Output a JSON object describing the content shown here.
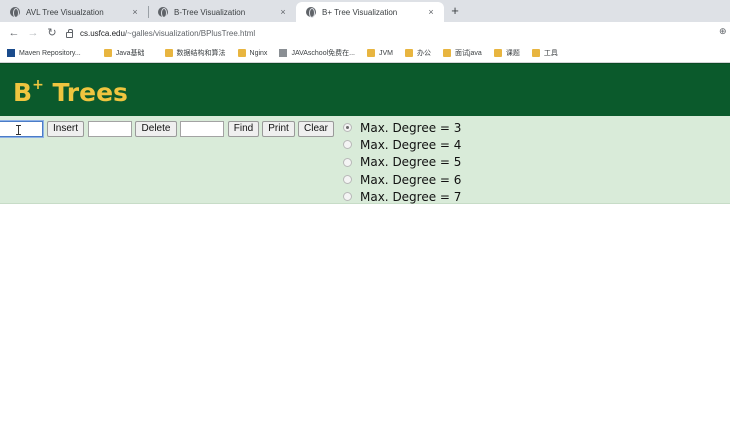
{
  "browser": {
    "tabs": [
      {
        "title": "AVL Tree Visualzation",
        "active": false
      },
      {
        "title": "B-Tree Visualization",
        "active": false
      },
      {
        "title": "B+ Tree Visualization",
        "active": true
      }
    ],
    "close_glyph": "×",
    "new_tab_glyph": "+",
    "url_host": "cs.usfca.edu",
    "url_path": "/~galles/visualization/BPlusTree.html",
    "nav": {
      "back": "←",
      "forward": "→",
      "reload": "↻"
    },
    "zoom_glyph": "⊕",
    "bookmarks": [
      {
        "label": "Maven Repository...",
        "icon": "maven-icon"
      },
      {
        "label": "Java基础",
        "icon": "folder-icon"
      },
      {
        "label": "数据结构和算法",
        "icon": "folder-icon"
      },
      {
        "label": "Nginx",
        "icon": "folder-icon"
      },
      {
        "label": "JAVAschool免费在...",
        "icon": "image-icon"
      },
      {
        "label": "JVM",
        "icon": "folder-icon"
      },
      {
        "label": "办公",
        "icon": "folder-icon"
      },
      {
        "label": "面试java",
        "icon": "folder-icon"
      },
      {
        "label": "课题",
        "icon": "folder-icon"
      },
      {
        "label": "工具",
        "icon": "folder-icon"
      }
    ]
  },
  "page": {
    "title_main": "B",
    "title_sup": "+",
    "title_rest": " Trees",
    "colors": {
      "header": "#0b5a2c",
      "title": "#efc53f",
      "controls_bg": "#d9ebd9"
    },
    "insert_field_value": "",
    "insert_label": "Insert",
    "delete_field_value": "",
    "delete_label": "Delete",
    "find_field_value": "",
    "find_label": "Find",
    "print_label": "Print",
    "clear_label": "Clear",
    "degree_options": [
      {
        "label": "Max. Degree = 3",
        "checked": true
      },
      {
        "label": "Max. Degree = 4",
        "checked": false
      },
      {
        "label": "Max. Degree = 5",
        "checked": false
      },
      {
        "label": "Max. Degree = 6",
        "checked": false
      },
      {
        "label": "Max. Degree = 7",
        "checked": false
      }
    ]
  }
}
